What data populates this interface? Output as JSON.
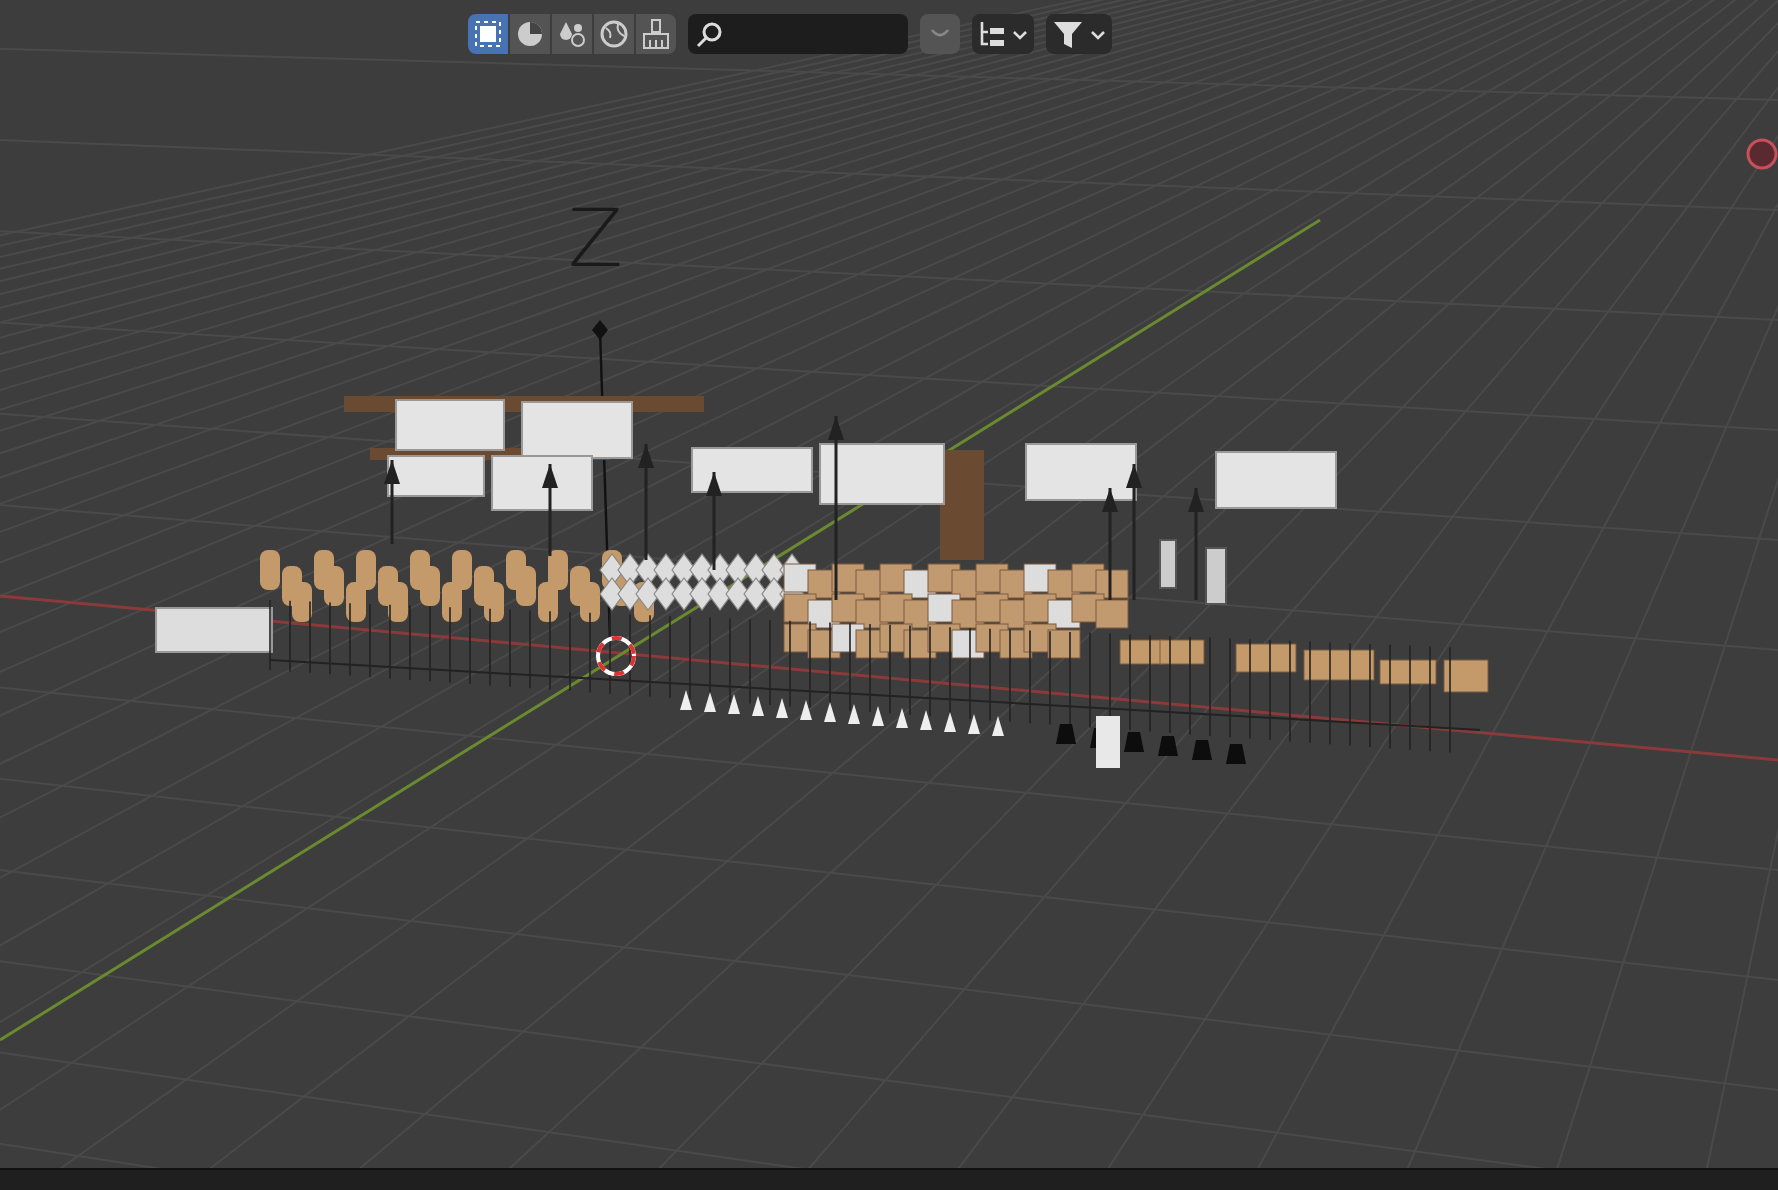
{
  "header": {
    "filter_buttons": [
      {
        "kind": "select",
        "selected": true
      },
      {
        "kind": "shading",
        "selected": false
      },
      {
        "kind": "particles",
        "selected": false
      },
      {
        "kind": "world",
        "selected": false
      },
      {
        "kind": "paint",
        "selected": false
      }
    ]
  },
  "viewport": {
    "axis_label": "Z"
  }
}
